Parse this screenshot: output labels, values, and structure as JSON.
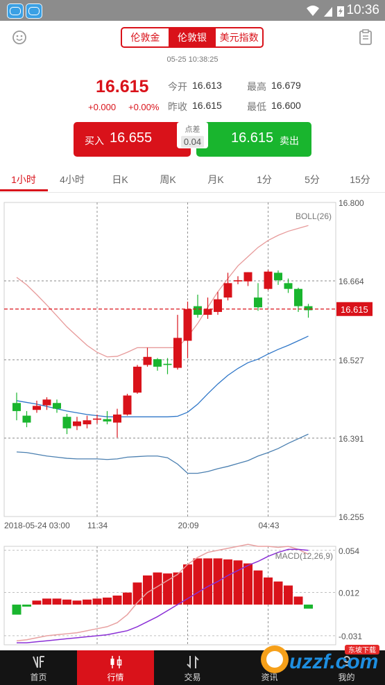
{
  "status_bar": {
    "time": "10:36"
  },
  "header": {
    "tabs": [
      {
        "label": "伦敦金",
        "active": false
      },
      {
        "label": "伦敦银",
        "active": true
      },
      {
        "label": "美元指数",
        "active": false
      }
    ],
    "left_icon": "smiley-icon",
    "right_icon": "clipboard-icon"
  },
  "quote": {
    "timestamp": "05-25 10:38:25",
    "price": "16.615",
    "change": "+0.000",
    "change_pct": "+0.00%",
    "open_label": "今开",
    "open": "16.613",
    "prev_close_label": "昨收",
    "prev_close": "16.615",
    "high_label": "最高",
    "high": "16.679",
    "low_label": "最低",
    "low": "16.600"
  },
  "trade": {
    "buy_label": "买入",
    "buy_price": "16.655",
    "sell_price": "16.615",
    "sell_label": "卖出",
    "spread_label": "点差",
    "spread": "0.04"
  },
  "period_tabs": [
    "1小时",
    "4小时",
    "日K",
    "周K",
    "月K",
    "1分",
    "5分",
    "15分"
  ],
  "active_period": 0,
  "colors": {
    "up": "#d9121a",
    "down": "#19b52e",
    "accent": "#d9121a"
  },
  "chart_data": [
    {
      "type": "candlestick",
      "indicator": "BOLL(26)",
      "yticks": [
        "16.800",
        "16.664",
        "16.527",
        "16.391",
        "16.255"
      ],
      "ylim": [
        16.255,
        16.8
      ],
      "current_price_label": "16.615",
      "current_price": 16.615,
      "xticks": [
        {
          "label": "2018-05-24 03:00",
          "i": 0
        },
        {
          "label": "11:34",
          "i": 8
        },
        {
          "label": "20:09",
          "i": 17
        },
        {
          "label": "04:43",
          "i": 25
        }
      ],
      "candles": [
        {
          "o": 16.452,
          "c": 16.438,
          "h": 16.47,
          "l": 16.422
        },
        {
          "o": 16.43,
          "c": 16.418,
          "h": 16.438,
          "l": 16.41
        },
        {
          "o": 16.44,
          "c": 16.447,
          "h": 16.456,
          "l": 16.435
        },
        {
          "o": 16.448,
          "c": 16.458,
          "h": 16.462,
          "l": 16.44
        },
        {
          "o": 16.452,
          "c": 16.442,
          "h": 16.458,
          "l": 16.435
        },
        {
          "o": 16.428,
          "c": 16.408,
          "h": 16.433,
          "l": 16.398
        },
        {
          "o": 16.412,
          "c": 16.42,
          "h": 16.428,
          "l": 16.405
        },
        {
          "o": 16.415,
          "c": 16.422,
          "h": 16.43,
          "l": 16.408
        },
        {
          "o": 16.423,
          "c": 16.425,
          "h": 16.432,
          "l": 16.416
        },
        {
          "o": 16.424,
          "c": 16.42,
          "h": 16.438,
          "l": 16.415
        },
        {
          "o": 16.418,
          "c": 16.432,
          "h": 16.442,
          "l": 16.392
        },
        {
          "o": 16.432,
          "c": 16.465,
          "h": 16.468,
          "l": 16.43
        },
        {
          "o": 16.47,
          "c": 16.515,
          "h": 16.518,
          "l": 16.468
        },
        {
          "o": 16.518,
          "c": 16.532,
          "h": 16.548,
          "l": 16.515
        },
        {
          "o": 16.528,
          "c": 16.515,
          "h": 16.53,
          "l": 16.508
        },
        {
          "o": 16.52,
          "c": 16.518,
          "h": 16.53,
          "l": 16.502
        },
        {
          "o": 16.513,
          "c": 16.565,
          "h": 16.605,
          "l": 16.51
        },
        {
          "o": 16.56,
          "c": 16.615,
          "h": 16.628,
          "l": 16.53
        },
        {
          "o": 16.62,
          "c": 16.605,
          "h": 16.64,
          "l": 16.6
        },
        {
          "o": 16.605,
          "c": 16.615,
          "h": 16.635,
          "l": 16.598
        },
        {
          "o": 16.61,
          "c": 16.632,
          "h": 16.645,
          "l": 16.605
        },
        {
          "o": 16.635,
          "c": 16.66,
          "h": 16.678,
          "l": 16.63
        },
        {
          "o": 16.663,
          "c": 16.665,
          "h": 16.672,
          "l": 16.658
        },
        {
          "o": 16.663,
          "c": 16.679,
          "h": 16.679,
          "l": 16.655
        },
        {
          "o": 16.635,
          "c": 16.618,
          "h": 16.66,
          "l": 16.612
        },
        {
          "o": 16.65,
          "c": 16.68,
          "h": 16.683,
          "l": 16.648
        },
        {
          "o": 16.678,
          "c": 16.665,
          "h": 16.682,
          "l": 16.657
        },
        {
          "o": 16.66,
          "c": 16.65,
          "h": 16.668,
          "l": 16.643
        },
        {
          "o": 16.65,
          "c": 16.62,
          "h": 16.652,
          "l": 16.61
        },
        {
          "o": 16.62,
          "c": 16.613,
          "h": 16.624,
          "l": 16.6
        }
      ],
      "boll_upper": [
        16.67,
        16.657,
        16.64,
        16.622,
        16.603,
        16.584,
        16.568,
        16.552,
        16.54,
        16.532,
        16.533,
        16.54,
        16.548,
        16.548,
        16.548,
        16.548,
        16.548,
        16.567,
        16.59,
        16.618,
        16.645,
        16.668,
        16.69,
        16.706,
        16.722,
        16.734,
        16.743,
        16.75,
        16.755,
        16.76
      ],
      "boll_mid": [
        16.456,
        16.453,
        16.45,
        16.446,
        16.442,
        16.438,
        16.435,
        16.432,
        16.43,
        16.428,
        16.428,
        16.428,
        16.428,
        16.428,
        16.428,
        16.428,
        16.429,
        16.436,
        16.45,
        16.468,
        16.485,
        16.5,
        16.512,
        16.522,
        16.528,
        16.537,
        16.545,
        16.552,
        16.56,
        16.568
      ],
      "boll_lower": [
        16.367,
        16.366,
        16.363,
        16.36,
        16.358,
        16.356,
        16.355,
        16.355,
        16.355,
        16.354,
        16.355,
        16.358,
        16.359,
        16.36,
        16.36,
        16.357,
        16.346,
        16.33,
        16.33,
        16.333,
        16.338,
        16.342,
        16.347,
        16.352,
        16.36,
        16.366,
        16.373,
        16.382,
        16.39,
        16.398
      ]
    },
    {
      "type": "bar+line",
      "indicator": "MACD(12,26,9)",
      "yticks": [
        "0.054",
        "0.012",
        "-0.031"
      ],
      "ylim": [
        -0.04,
        0.058
      ],
      "histogram": [
        -0.01,
        -0.002,
        0.004,
        0.006,
        0.006,
        0.005,
        0.004,
        0.005,
        0.006,
        0.007,
        0.009,
        0.012,
        0.022,
        0.029,
        0.032,
        0.031,
        0.032,
        0.04,
        0.046,
        0.046,
        0.046,
        0.045,
        0.044,
        0.041,
        0.034,
        0.027,
        0.023,
        0.019,
        0.008,
        -0.004
      ],
      "dif": [
        -0.036,
        -0.035,
        -0.033,
        -0.031,
        -0.03,
        -0.029,
        -0.028,
        -0.026,
        -0.024,
        -0.022,
        -0.018,
        -0.01,
        0.002,
        0.012,
        0.018,
        0.024,
        0.03,
        0.04,
        0.047,
        0.052,
        0.054,
        0.056,
        0.058,
        0.06,
        0.058,
        0.058,
        0.057,
        0.058,
        0.055,
        0.05
      ],
      "dea": [
        -0.038,
        -0.038,
        -0.037,
        -0.036,
        -0.035,
        -0.034,
        -0.033,
        -0.032,
        -0.031,
        -0.03,
        -0.028,
        -0.026,
        -0.022,
        -0.017,
        -0.012,
        -0.006,
        0.0,
        0.006,
        0.012,
        0.018,
        0.023,
        0.029,
        0.034,
        0.039,
        0.043,
        0.048,
        0.052,
        0.055,
        0.055,
        0.054
      ]
    }
  ],
  "bottom_nav": [
    {
      "label": "首页",
      "icon": "home-logo-icon",
      "active": false
    },
    {
      "label": "行情",
      "icon": "candlestick-icon",
      "active": true
    },
    {
      "label": "交易",
      "icon": "trade-icon",
      "active": false
    },
    {
      "label": "资讯",
      "icon": "news-icon",
      "active": false
    },
    {
      "label": "我的",
      "icon": "profile-icon",
      "active": false
    }
  ],
  "watermark": {
    "site": "uzzf.com",
    "tag": "东坡下载"
  }
}
